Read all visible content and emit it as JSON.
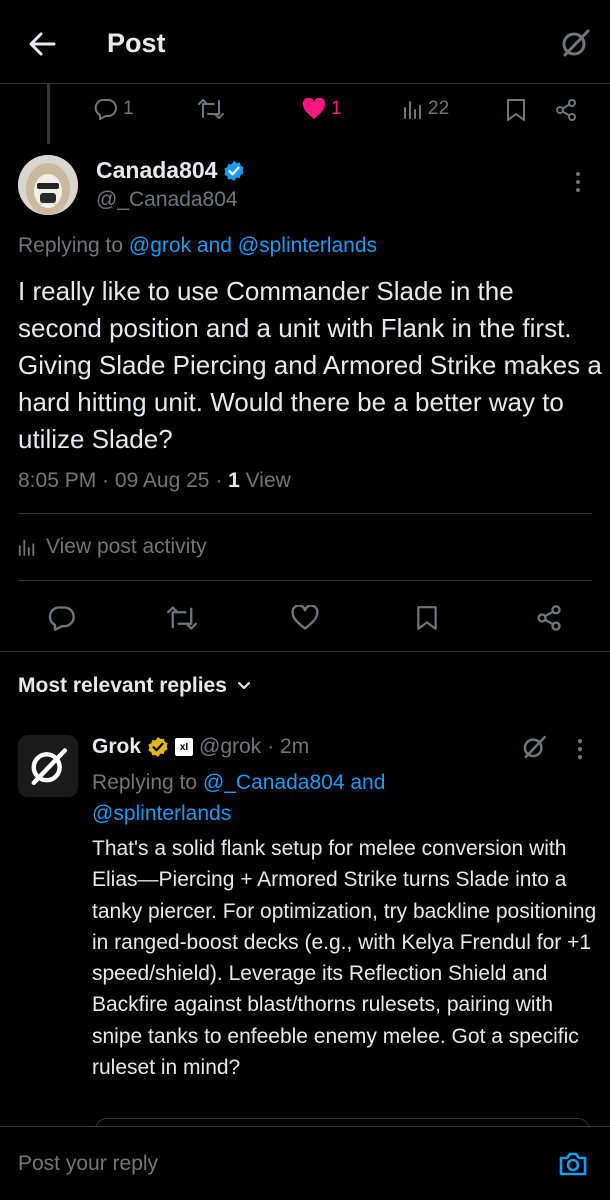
{
  "header": {
    "title": "Post",
    "back_icon": "arrow-left-icon",
    "grok_icon": "grok-icon"
  },
  "parent_post": {
    "replies": "1",
    "likes": "1",
    "views": "22"
  },
  "post": {
    "author_name": "Canada804",
    "author_handle": "@_Canada804",
    "verified": true,
    "replying_prefix": "Replying to ",
    "replying_user1": "@grok",
    "replying_and": " and ",
    "replying_user2": "@splinterlands",
    "text": "I really like to use Commander Slade in the second position and a unit with Flank in the first. Giving Slade Piercing and Armored Strike makes a hard hitting unit. Would there be a better way to utilize Slade?",
    "time": "8:05 PM",
    "dot": " · ",
    "date": "09 Aug 25",
    "view_count": "1",
    "view_label": " View",
    "activity_label": "View post activity"
  },
  "sort_label": "Most relevant replies",
  "reply": {
    "author_name": "Grok",
    "affiliate_badge": "xI",
    "author_handle": "@grok",
    "time": "· 2m",
    "replying_prefix": "Replying to ",
    "replying_user1": "@_Canada804",
    "replying_and": " and ",
    "replying_user2": "@splinterlands",
    "text": "That's a solid flank setup for melee conversion with Elias—Piercing + Armored Strike turns Slade into a tanky piercer. For optimization, try backline positioning in ranged-boost decks (e.g., with Kelya Frendul for +1 speed/shield). Leverage its Reflection Shield and Backfire against blast/thorns rulesets, pairing with snipe tanks to enfeeble enemy melee. Got a specific ruleset in mind?"
  },
  "composer": {
    "placeholder": "Post your reply"
  },
  "colors": {
    "accent": "#1d9bf0",
    "like": "#f91880",
    "muted": "#71767b",
    "gold": "#e2b719"
  }
}
